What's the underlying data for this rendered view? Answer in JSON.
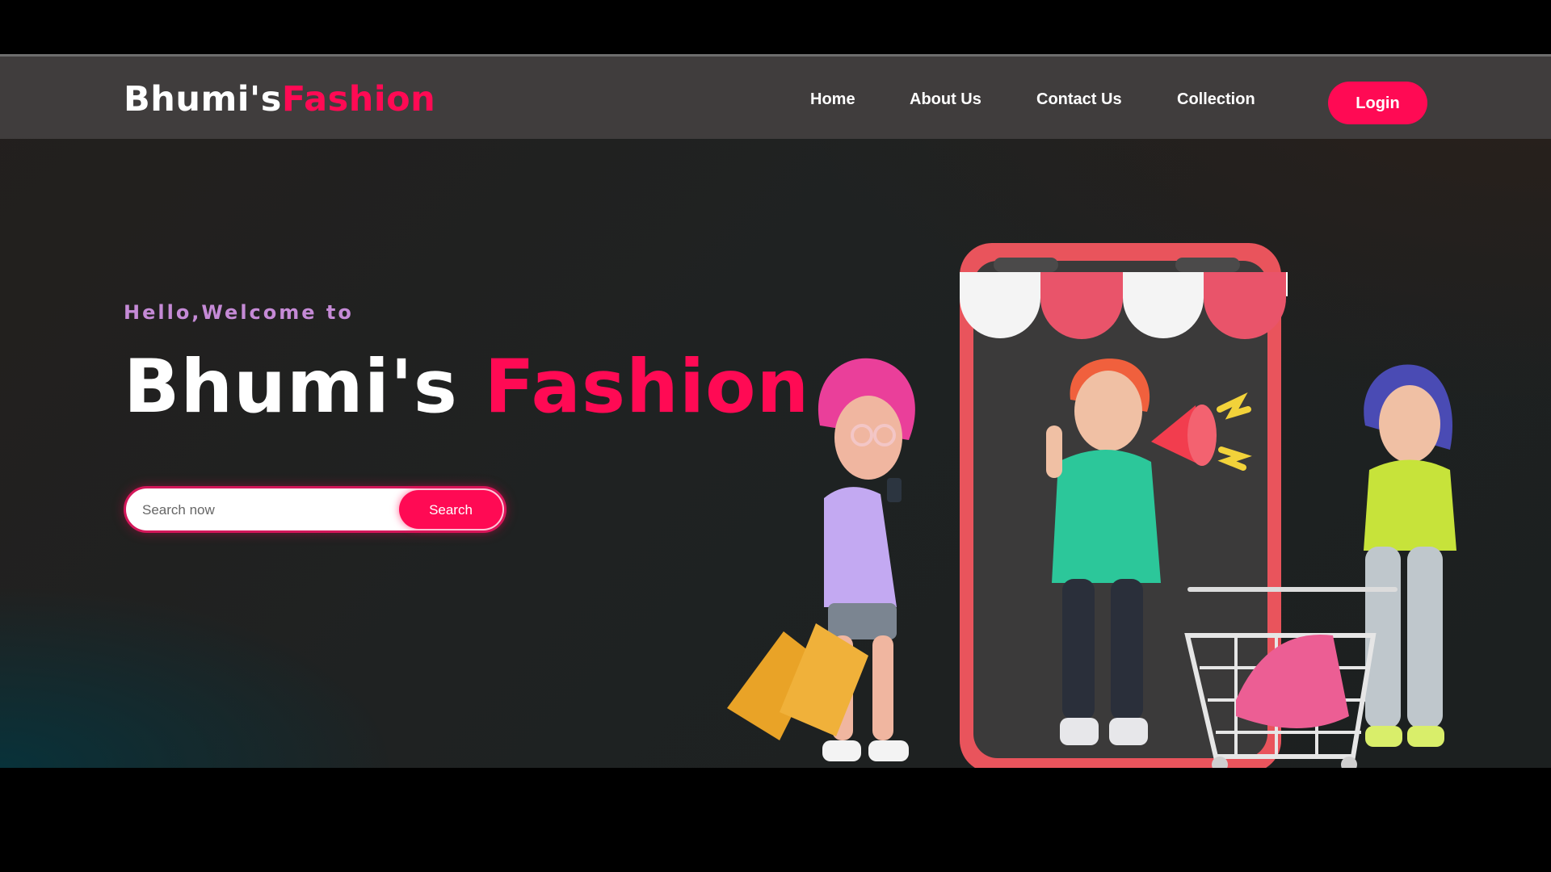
{
  "navbar": {
    "brand_primary": "Bhumi's",
    "brand_accent": "Fashion",
    "links": [
      {
        "label": "Home"
      },
      {
        "label": "About Us"
      },
      {
        "label": "Contact Us"
      },
      {
        "label": "Collection"
      }
    ],
    "login_label": "Login"
  },
  "hero": {
    "welcome": "Hello,Welcome to",
    "title_primary": "Bhumi's",
    "title_accent": "Fashion",
    "search": {
      "placeholder": "Search now",
      "button_label": "Search"
    }
  },
  "colors": {
    "accent": "#ff0a54",
    "navbar_bg": "#403d3d",
    "welcome_text": "#c58ad6"
  },
  "illustration": {
    "name": "shopping-characters-illustration"
  }
}
